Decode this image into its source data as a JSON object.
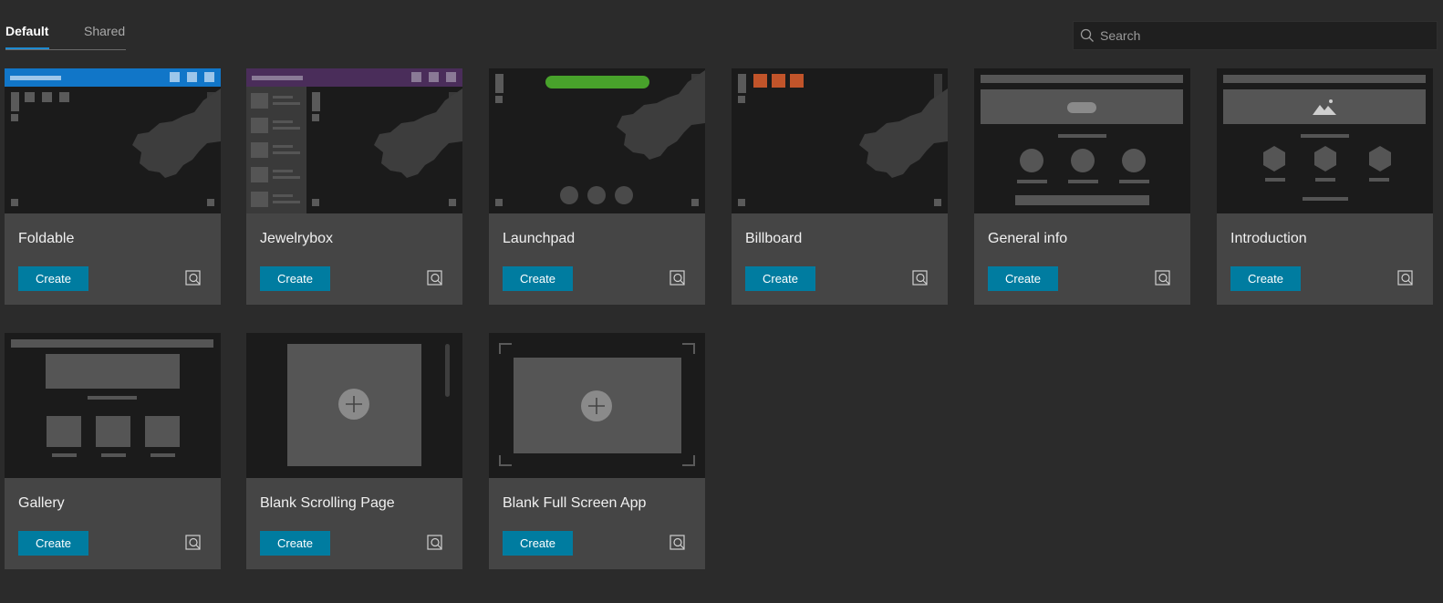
{
  "tabs": [
    {
      "label": "Default",
      "active": true
    },
    {
      "label": "Shared",
      "active": false
    }
  ],
  "search": {
    "placeholder": "Search",
    "value": ""
  },
  "colors": {
    "accent": "#1e8bd0",
    "create_button": "#007ca0"
  },
  "cards": [
    {
      "title": "Foldable",
      "button": "Create",
      "preview_icon": "preview-icon",
      "header_color": "#1176c8"
    },
    {
      "title": "Jewelrybox",
      "button": "Create",
      "preview_icon": "preview-icon",
      "header_color": "#4a2d5a"
    },
    {
      "title": "Launchpad",
      "button": "Create",
      "preview_icon": "preview-icon",
      "bar_color": "#48a22b"
    },
    {
      "title": "Billboard",
      "button": "Create",
      "preview_icon": "preview-icon",
      "accent_color": "#c1542a"
    },
    {
      "title": "General info",
      "button": "Create",
      "preview_icon": "preview-icon"
    },
    {
      "title": "Introduction",
      "button": "Create",
      "preview_icon": "preview-icon"
    },
    {
      "title": "Gallery",
      "button": "Create",
      "preview_icon": "preview-icon"
    },
    {
      "title": "Blank Scrolling Page",
      "button": "Create",
      "preview_icon": "preview-icon"
    },
    {
      "title": "Blank Full Screen App",
      "button": "Create",
      "preview_icon": "preview-icon"
    }
  ]
}
